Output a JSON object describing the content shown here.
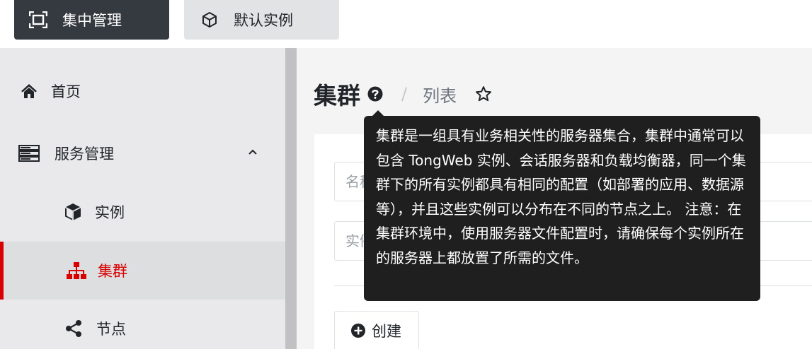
{
  "topbar": {
    "central_label": "集中管理",
    "instance_label": "默认实例"
  },
  "sidebar": {
    "home": "首页",
    "service_mgmt": "服务管理",
    "instance": "实例",
    "cluster": "集群",
    "node": "节点"
  },
  "page": {
    "title": "集群",
    "separator": "/",
    "breadcrumb": "列表"
  },
  "tooltip": {
    "text": "集群是一组具有业务相关性的服务器集合，集群中通常可以包含 TongWeb 实例、会话服务器和负载均衡器，同一个集群下的所有实例都具有相同的配置（如部署的应用、数据源等），并且这些实例可以分布在不同的节点之上。 注意：在集群环境中，使用服务器文件配置时，请确保每个实例所在的服务器上都放置了所需的文件。"
  },
  "filters": {
    "name_placeholder": "名称",
    "instance_placeholder": "实例"
  },
  "actions": {
    "create_label": "创建"
  },
  "colors": {
    "accent_red": "#d90000",
    "topbar_dark": "#343a40",
    "tooltip_bg": "#1f1f1f"
  },
  "icons": [
    "central-manage-icon",
    "cube-icon",
    "home-icon",
    "server-icon",
    "chevron-up-icon",
    "sitemap-icon",
    "share-icon",
    "help-icon",
    "star-icon",
    "plus-circle-icon"
  ]
}
